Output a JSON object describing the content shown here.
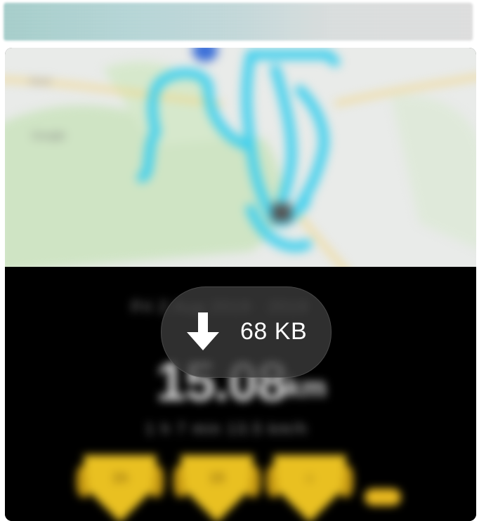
{
  "download": {
    "size_label": "68 KB",
    "icon": "download-arrow-icon"
  },
  "activity": {
    "date": "Fri 2 Aug 2019 · 2019",
    "distance": "15.08",
    "unit": "km",
    "summary": "1 h 7 min   13.5 km/h"
  },
  "badges": [
    {
      "glyph": "1h"
    },
    {
      "glyph": "15"
    },
    {
      "glyph": "☺"
    }
  ],
  "colors": {
    "route": "#3fd0ee",
    "badge": "#e9c021",
    "map_background": "#e9ebe9",
    "stats_background": "#000000"
  }
}
